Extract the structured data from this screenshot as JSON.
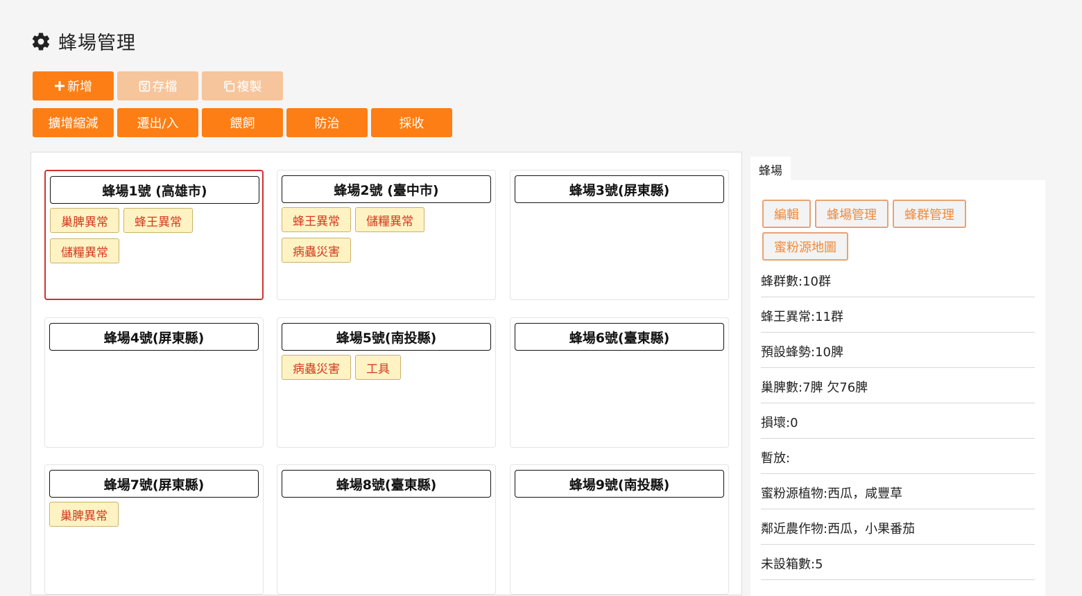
{
  "header": {
    "title": "蜂場管理",
    "icon": "gear-icon"
  },
  "toolbar": {
    "add_label": "新增",
    "save_label": "存檔",
    "copy_label": "複製",
    "expand_label": "擴增縮減",
    "move_label": "遷出/入",
    "feed_label": "餵飼",
    "prevent_label": "防治",
    "harvest_label": "採收"
  },
  "apiaries": [
    {
      "name": "蜂場1號 (高雄市)",
      "selected": true,
      "tags": [
        "巢脾異常",
        "蜂王異常",
        "儲糧異常"
      ]
    },
    {
      "name": "蜂場2號 (臺中市)",
      "selected": false,
      "tags": [
        "蜂王異常",
        "儲糧異常",
        "病蟲災害"
      ]
    },
    {
      "name": "蜂場3號(屏東縣)",
      "selected": false,
      "tags": []
    },
    {
      "name": "蜂場4號(屏東縣)",
      "selected": false,
      "tags": []
    },
    {
      "name": "蜂場5號(南投縣)",
      "selected": false,
      "tags": [
        "病蟲災害",
        "工具"
      ]
    },
    {
      "name": "蜂場6號(臺東縣)",
      "selected": false,
      "tags": []
    },
    {
      "name": "蜂場7號(屏東縣)",
      "selected": false,
      "tags": [
        "巢脾異常"
      ]
    },
    {
      "name": "蜂場8號(臺東縣)",
      "selected": false,
      "tags": []
    },
    {
      "name": "蜂場9號(南投縣)",
      "selected": false,
      "tags": []
    }
  ],
  "side": {
    "tab_label": "蜂場",
    "buttons": [
      "編輯",
      "蜂場管理",
      "蜂群管理",
      "蜜粉源地圖"
    ],
    "info": [
      "蜂群數:10群",
      "蜂王異常:11群",
      "預設蜂勢:10脾",
      "巢脾數:7脾 欠76脾",
      "損壞:0",
      "暫放:",
      "蜜粉源植物:西瓜，咸豐草",
      "鄰近農作物:西瓜，小果番茄",
      "未設箱數:5"
    ]
  },
  "colors": {
    "accent": "#fd7e14",
    "accent_disabled": "#f6c59c",
    "tag_bg": "#fff3c4",
    "tag_text": "#d23a1e",
    "selected_border": "#d32f2f"
  }
}
